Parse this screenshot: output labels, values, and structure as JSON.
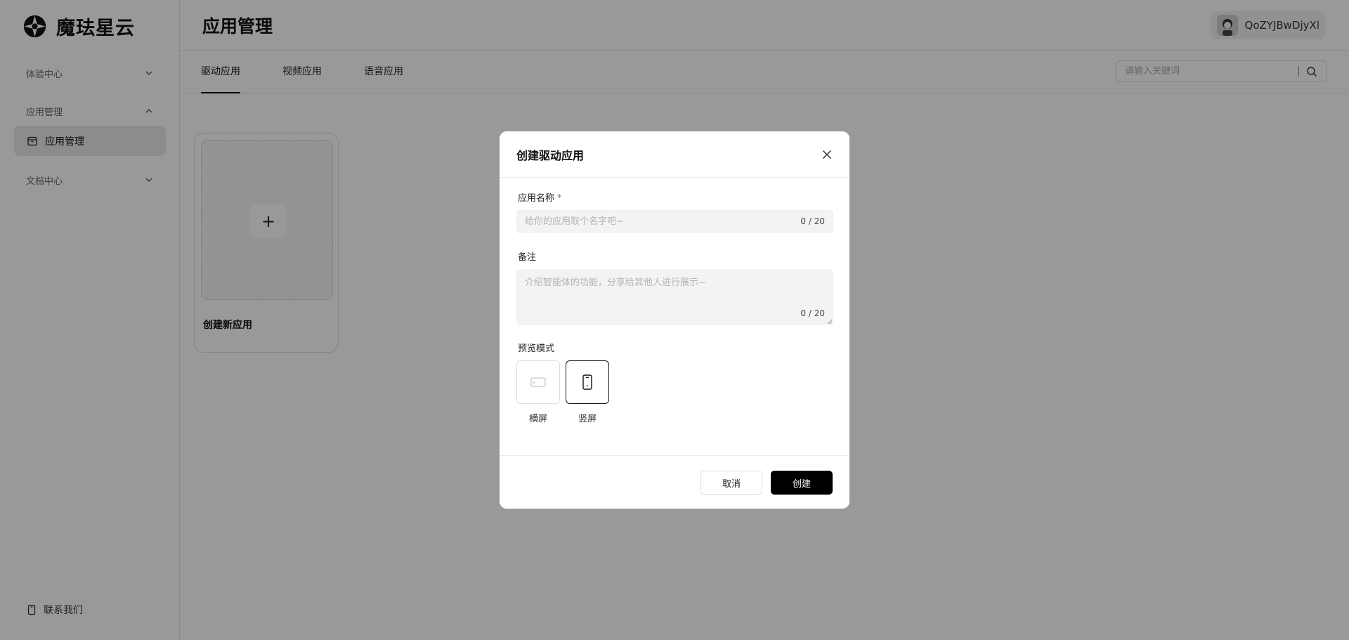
{
  "brand": {
    "name": "魔珐星云"
  },
  "sidebar": {
    "groups": [
      {
        "label": "体验中心",
        "expanded": false
      },
      {
        "label": "应用管理",
        "expanded": true,
        "items": [
          {
            "label": "应用管理",
            "icon": "box-icon",
            "active": true
          }
        ]
      },
      {
        "label": "文档中心",
        "expanded": false
      }
    ],
    "contact_label": "联系我们"
  },
  "header": {
    "title": "应用管理",
    "user_name": "QoZYJBwDjyXl"
  },
  "tabs": [
    {
      "label": "驱动应用",
      "active": true
    },
    {
      "label": "视频应用",
      "active": false
    },
    {
      "label": "语音应用",
      "active": false
    }
  ],
  "search": {
    "placeholder": "请输入关键词"
  },
  "new_card": {
    "plus": "+",
    "label": "创建新应用"
  },
  "modal": {
    "title": "创建驱动应用",
    "name_field": {
      "label": "应用名称",
      "required_mark": "*",
      "placeholder": "给你的应用取个名字吧~",
      "value": "",
      "counter": "0 / 20"
    },
    "note_field": {
      "label": "备注",
      "placeholder": "介绍智能体的功能，分享给其他人进行展示~",
      "value": "",
      "counter": "0 / 20"
    },
    "preview_mode": {
      "label": "预览模式",
      "options": [
        {
          "label": "横屏",
          "icon": "landscape-icon",
          "selected": false
        },
        {
          "label": "竖屏",
          "icon": "portrait-icon",
          "selected": true
        }
      ]
    },
    "cancel_label": "取消",
    "create_label": "创建"
  },
  "colors": {
    "primary": "#000000",
    "required": "#e54545",
    "overlay": "rgba(0,0,0,0.40)"
  }
}
